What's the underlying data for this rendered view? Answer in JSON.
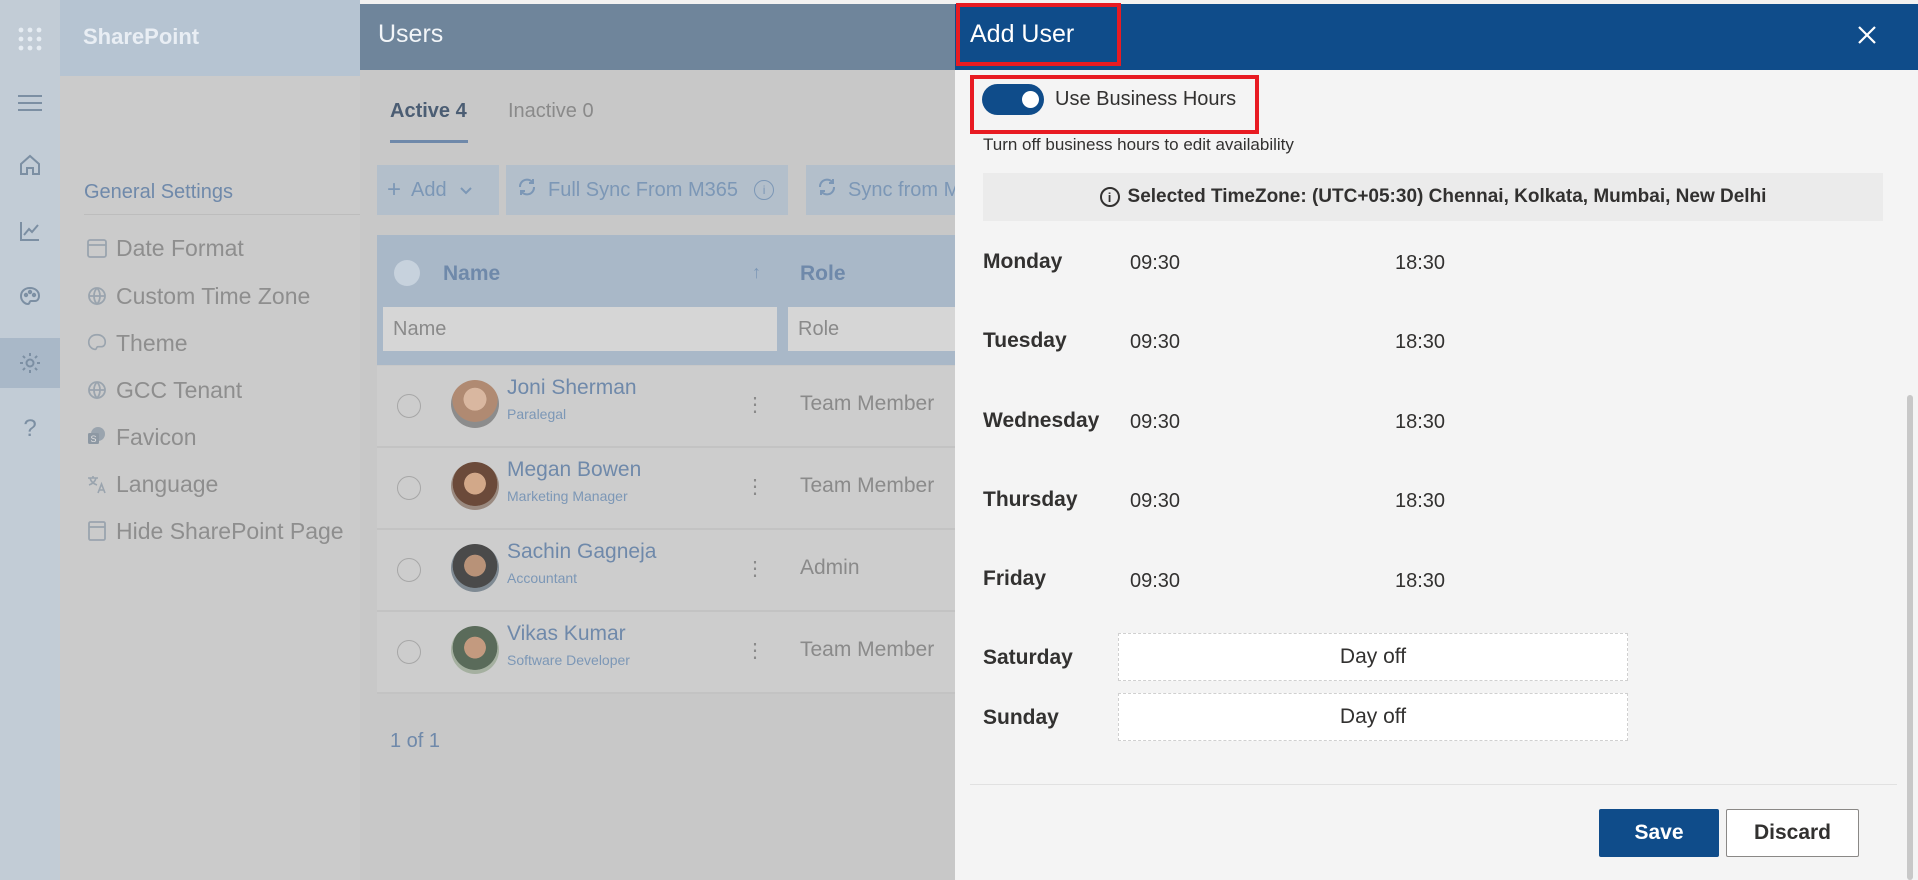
{
  "suite": {
    "brand": "SharePoint"
  },
  "users_panel": {
    "title": "Users",
    "tabs": [
      {
        "label": "Active 4"
      },
      {
        "label": "Inactive 0"
      }
    ],
    "commands": {
      "add": "Add",
      "full_sync": "Full Sync From M365",
      "sync_from": "Sync from M"
    },
    "columns": {
      "name": "Name",
      "role": "Role"
    },
    "filters": {
      "name_placeholder": "Name",
      "role_placeholder": "Role"
    },
    "rows": [
      {
        "name": "Joni Sherman",
        "title": "Paralegal",
        "role": "Team Member"
      },
      {
        "name": "Megan Bowen",
        "title": "Marketing Manager",
        "role": "Team Member"
      },
      {
        "name": "Sachin Gagneja",
        "title": "Accountant",
        "role": "Admin"
      },
      {
        "name": "Vikas Kumar",
        "title": "Software Developer",
        "role": "Team Member"
      }
    ],
    "pager": "1 of 1"
  },
  "settings": {
    "title": "General Settings",
    "items": [
      {
        "label": "Date Format"
      },
      {
        "label": "Custom Time Zone"
      },
      {
        "label": "Theme"
      },
      {
        "label": "GCC Tenant"
      },
      {
        "label": "Favicon"
      },
      {
        "label": "Language"
      },
      {
        "label": "Hide SharePoint Page"
      }
    ]
  },
  "dialog": {
    "title": "Add User",
    "toggle_label": "Use Business Hours",
    "hint": "Turn off business hours to edit availability",
    "timezone": "Selected TimeZone: (UTC+05:30) Chennai, Kolkata, Mumbai, New Delhi",
    "days": [
      {
        "day": "Monday",
        "start": "09:30",
        "end": "18:30"
      },
      {
        "day": "Tuesday",
        "start": "09:30",
        "end": "18:30"
      },
      {
        "day": "Wednesday",
        "start": "09:30",
        "end": "18:30"
      },
      {
        "day": "Thursday",
        "start": "09:30",
        "end": "18:30"
      },
      {
        "day": "Friday",
        "start": "09:30",
        "end": "18:30"
      },
      {
        "day": "Saturday",
        "status": "Day off"
      },
      {
        "day": "Sunday",
        "status": "Day off"
      }
    ],
    "save_label": "Save",
    "discard_label": "Discard"
  },
  "colors": {
    "accent": "#0f4c8a",
    "highlight": "#e81b22"
  }
}
